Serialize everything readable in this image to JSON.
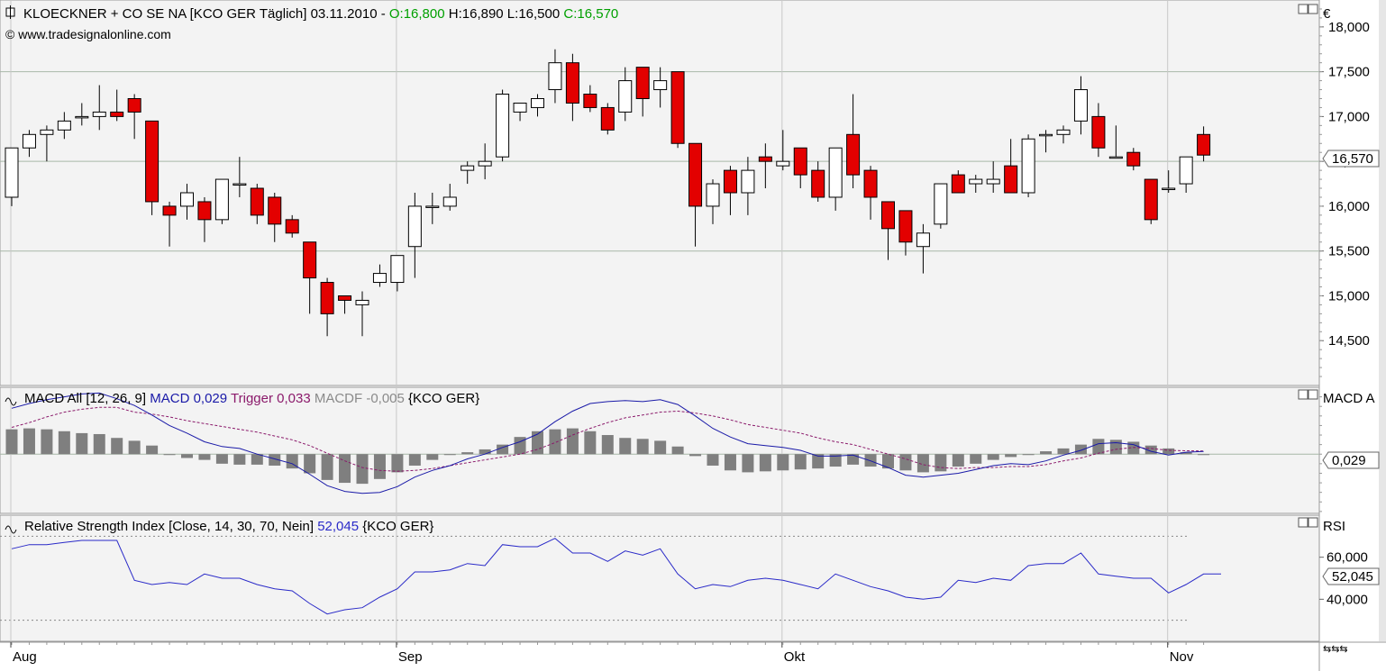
{
  "price_header": {
    "symbol_text": "KLOECKNER + CO SE NA [KCO GER  Täglich] 03.11.2010 - ",
    "open_text": "O:16,800",
    "high_text": " H:16,890",
    "low_text": " L:16,500",
    "close_text": " C:16,570",
    "source_text": "© www.tradesignalonline.com",
    "currency": "€",
    "last_price": "16,570"
  },
  "macd_header": {
    "name_text": "MACD All [12, 26, 9]",
    "macd_text": " MACD 0,029",
    "trigger_text": " Trigger 0,033",
    "macdf_text": " MACDF -0,005",
    "symbol_text": " {KCO GER}",
    "axis_label": "MACD A",
    "last_value": "0,029"
  },
  "rsi_header": {
    "name_text": "Relative Strength Index [Close, 14, 30, 70, Nein]",
    "value_text": " 52,045",
    "symbol_text": " {KCO GER}",
    "axis_label": "RSI",
    "last_value": "52,045"
  },
  "colors": {
    "background": "#f3f3f3",
    "up_candle": "#ffffff",
    "down_candle": "#e30000",
    "open_green": "#00a000",
    "macd_line": "#1a1aa8",
    "trigger_line": "#8b1a6b",
    "histogram": "#7f7f7f",
    "rsi_line": "#2a2ac8"
  },
  "chart_data": [
    {
      "type": "candlestick",
      "title": "KLOECKNER + CO SE NA [KCO GER  Täglich] 03.11.2010",
      "ylabel": "€",
      "ylim": [
        14000,
        18300
      ],
      "ytick_labels": [
        "18,000",
        "17,500",
        "17,000",
        "16,500",
        "16,000",
        "15,500",
        "15,000",
        "14,500"
      ],
      "yticks": [
        18000,
        17500,
        17000,
        16500,
        16000,
        15500,
        15000,
        14500
      ],
      "xtick_labels": [
        "Aug",
        "Sep",
        "Okt",
        "Nov"
      ],
      "xtick_index": [
        0,
        22,
        44,
        66
      ],
      "candles": [
        [
          16100,
          16650,
          16000,
          16650
        ],
        [
          16650,
          16850,
          16550,
          16800
        ],
        [
          16800,
          16900,
          16500,
          16850
        ],
        [
          16850,
          17050,
          16750,
          16950
        ],
        [
          17000,
          17150,
          16900,
          17000
        ],
        [
          17000,
          17350,
          16850,
          17050
        ],
        [
          17050,
          17300,
          16950,
          17000
        ],
        [
          17200,
          17250,
          16750,
          17050
        ],
        [
          16950,
          16950,
          15900,
          16050
        ],
        [
          16000,
          16050,
          15550,
          15900
        ],
        [
          16000,
          16250,
          15850,
          16150
        ],
        [
          16050,
          16100,
          15600,
          15850
        ],
        [
          15850,
          16300,
          15800,
          16300
        ],
        [
          16250,
          16550,
          16100,
          16250
        ],
        [
          16200,
          16250,
          15800,
          15900
        ],
        [
          16100,
          16150,
          15600,
          15800
        ],
        [
          15850,
          15900,
          15650,
          15700
        ],
        [
          15600,
          15600,
          14800,
          15200
        ],
        [
          15150,
          15200,
          14550,
          14800
        ],
        [
          15000,
          15000,
          14800,
          14950
        ],
        [
          14900,
          15050,
          14550,
          14950
        ],
        [
          15150,
          15350,
          15100,
          15250
        ],
        [
          15150,
          15450,
          15050,
          15450
        ],
        [
          15550,
          16150,
          15200,
          16000
        ],
        [
          16000,
          16150,
          15800,
          16000
        ],
        [
          16000,
          16250,
          15950,
          16100
        ],
        [
          16400,
          16500,
          16250,
          16450
        ],
        [
          16450,
          16700,
          16300,
          16500
        ],
        [
          16550,
          17300,
          16500,
          17250
        ],
        [
          17050,
          17150,
          16950,
          17150
        ],
        [
          17100,
          17250,
          17000,
          17200
        ],
        [
          17300,
          17750,
          17150,
          17600
        ],
        [
          17600,
          17700,
          16950,
          17150
        ],
        [
          17250,
          17350,
          17050,
          17100
        ],
        [
          17100,
          17150,
          16800,
          16850
        ],
        [
          17050,
          17550,
          16950,
          17400
        ],
        [
          17550,
          17550,
          17000,
          17200
        ],
        [
          17300,
          17550,
          17100,
          17400
        ],
        [
          17500,
          17500,
          16650,
          16700
        ],
        [
          16700,
          16700,
          15550,
          16000
        ],
        [
          16000,
          16300,
          15800,
          16250
        ],
        [
          16400,
          16450,
          15900,
          16150
        ],
        [
          16150,
          16550,
          15900,
          16400
        ],
        [
          16550,
          16700,
          16200,
          16500
        ],
        [
          16450,
          16850,
          16400,
          16500
        ],
        [
          16650,
          16650,
          16200,
          16350
        ],
        [
          16400,
          16500,
          16050,
          16100
        ],
        [
          16100,
          16650,
          15950,
          16650
        ],
        [
          16800,
          17250,
          16200,
          16350
        ],
        [
          16400,
          16450,
          15850,
          16100
        ],
        [
          16050,
          16050,
          15400,
          15750
        ],
        [
          15950,
          15950,
          15450,
          15600
        ],
        [
          15550,
          15800,
          15250,
          15700
        ],
        [
          15800,
          16250,
          15750,
          16250
        ],
        [
          16350,
          16400,
          16150,
          16150
        ],
        [
          16250,
          16350,
          16150,
          16300
        ],
        [
          16250,
          16500,
          16150,
          16300
        ],
        [
          16450,
          16750,
          16150,
          16150
        ],
        [
          16150,
          16800,
          16100,
          16750
        ],
        [
          16800,
          16850,
          16600,
          16800
        ],
        [
          16800,
          16900,
          16700,
          16850
        ],
        [
          16950,
          17450,
          16800,
          17300
        ],
        [
          17000,
          17150,
          16550,
          16650
        ],
        [
          16550,
          16900,
          16550,
          16550
        ],
        [
          16600,
          16650,
          16400,
          16450
        ],
        [
          16300,
          16300,
          15800,
          15850
        ],
        [
          16200,
          16400,
          16150,
          16200
        ],
        [
          16250,
          16550,
          16150,
          16550
        ],
        [
          16800,
          16890,
          16500,
          16570
        ]
      ]
    },
    {
      "type": "line",
      "title": "MACD All [12, 26, 9]",
      "ylim": [
        -0.62,
        0.7
      ],
      "series": [
        {
          "name": "MACD",
          "values": [
            0.48,
            0.53,
            0.57,
            0.6,
            0.63,
            0.64,
            0.58,
            0.51,
            0.41,
            0.3,
            0.22,
            0.13,
            0.08,
            0.06,
            0.0,
            -0.05,
            -0.1,
            -0.21,
            -0.33,
            -0.39,
            -0.41,
            -0.4,
            -0.34,
            -0.24,
            -0.17,
            -0.12,
            -0.05,
            0.0,
            0.07,
            0.13,
            0.21,
            0.34,
            0.45,
            0.53,
            0.55,
            0.56,
            0.55,
            0.57,
            0.52,
            0.4,
            0.27,
            0.18,
            0.11,
            0.09,
            0.07,
            0.04,
            -0.02,
            -0.02,
            -0.01,
            -0.07,
            -0.14,
            -0.22,
            -0.24,
            -0.22,
            -0.2,
            -0.16,
            -0.12,
            -0.1,
            -0.11,
            -0.07,
            -0.01,
            0.04,
            0.11,
            0.12,
            0.1,
            0.03,
            -0.01,
            0.02,
            0.029
          ]
        },
        {
          "name": "Trigger",
          "values": [
            0.28,
            0.33,
            0.39,
            0.44,
            0.47,
            0.49,
            0.49,
            0.44,
            0.42,
            0.39,
            0.35,
            0.32,
            0.29,
            0.26,
            0.23,
            0.19,
            0.15,
            0.09,
            0.01,
            -0.07,
            -0.14,
            -0.17,
            -0.18,
            -0.17,
            -0.15,
            -0.12,
            -0.09,
            -0.06,
            -0.03,
            0.0,
            0.05,
            0.12,
            0.2,
            0.27,
            0.33,
            0.38,
            0.41,
            0.44,
            0.45,
            0.43,
            0.4,
            0.36,
            0.31,
            0.28,
            0.25,
            0.22,
            0.17,
            0.13,
            0.1,
            0.05,
            0.0,
            -0.05,
            -0.11,
            -0.14,
            -0.15,
            -0.14,
            -0.14,
            -0.13,
            -0.13,
            -0.11,
            -0.07,
            -0.04,
            0.01,
            0.05,
            0.07,
            0.06,
            0.04,
            0.035,
            0.033
          ]
        },
        {
          "name": "MACDF",
          "values": [
            0.26,
            0.27,
            0.26,
            0.24,
            0.22,
            0.21,
            0.17,
            0.14,
            0.09,
            0.0,
            -0.04,
            -0.06,
            -0.1,
            -0.11,
            -0.11,
            -0.12,
            -0.15,
            -0.2,
            -0.27,
            -0.3,
            -0.31,
            -0.26,
            -0.19,
            -0.12,
            -0.06,
            0.0,
            0.02,
            0.05,
            0.1,
            0.18,
            0.24,
            0.26,
            0.27,
            0.24,
            0.2,
            0.17,
            0.16,
            0.14,
            0.08,
            -0.02,
            -0.12,
            -0.17,
            -0.19,
            -0.18,
            -0.17,
            -0.16,
            -0.15,
            -0.13,
            -0.11,
            -0.13,
            -0.15,
            -0.17,
            -0.19,
            -0.18,
            -0.13,
            -0.1,
            -0.06,
            -0.03,
            0.0,
            0.03,
            0.06,
            0.1,
            0.16,
            0.15,
            0.13,
            0.09,
            0.06,
            0.02,
            -0.005
          ]
        }
      ]
    },
    {
      "type": "line",
      "title": "Relative Strength Index [Close, 14, 30, 70, Nein]",
      "ylim": [
        20,
        80
      ],
      "ytick_labels": [
        "60,000",
        "40,000"
      ],
      "yticks": [
        60,
        40
      ],
      "hlines": [
        70,
        30
      ],
      "series": [
        {
          "name": "RSI",
          "values": [
            64,
            66,
            66,
            67,
            68,
            68,
            68,
            49,
            47,
            48,
            47,
            52,
            50,
            50,
            47,
            45,
            44,
            38,
            33,
            35,
            36,
            41,
            45,
            53,
            53,
            54,
            57,
            56,
            66,
            65,
            65,
            69,
            62,
            62,
            58,
            63,
            61,
            64,
            52,
            45,
            47,
            46,
            49,
            50,
            49,
            47,
            45,
            52,
            49,
            46,
            44,
            41,
            40,
            41,
            49,
            48,
            50,
            49,
            56,
            57,
            57,
            62,
            52,
            51,
            50,
            50,
            43,
            47,
            52,
            52.045
          ]
        }
      ]
    }
  ]
}
